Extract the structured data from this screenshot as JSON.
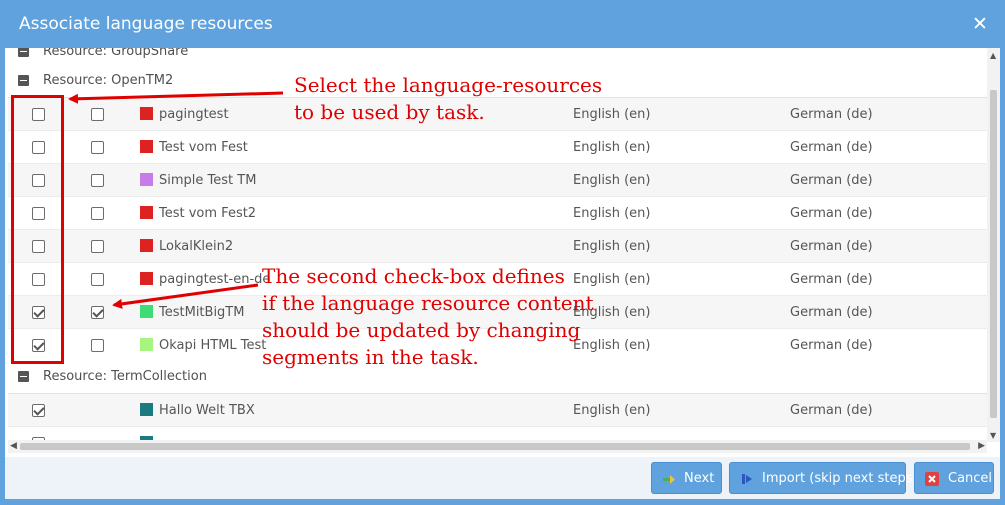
{
  "dialog": {
    "title": "Associate language resources",
    "close_icon": "close-icon"
  },
  "groups": {
    "groupshare": "Resource: GroupShare",
    "opentm2": "Resource: OpenTM2",
    "termcollection": "Resource: TermCollection"
  },
  "rows": [
    {
      "name": "pagingtest",
      "source": "English (en)",
      "target": "German (de)",
      "color": "#dd2222",
      "use": false,
      "update": false
    },
    {
      "name": "Test vom Fest",
      "source": "English (en)",
      "target": "German (de)",
      "color": "#dd2222",
      "use": false,
      "update": false
    },
    {
      "name": "Simple Test TM",
      "source": "English (en)",
      "target": "German (de)",
      "color": "#c67de8",
      "use": false,
      "update": false
    },
    {
      "name": "Test vom Fest2",
      "source": "English (en)",
      "target": "German (de)",
      "color": "#dd2222",
      "use": false,
      "update": false
    },
    {
      "name": "LokalKlein2",
      "source": "English (en)",
      "target": "German (de)",
      "color": "#dd2222",
      "use": false,
      "update": false
    },
    {
      "name": "pagingtest-en-de",
      "source": "English (en)",
      "target": "German (de)",
      "color": "#dd2222",
      "use": false,
      "update": false
    },
    {
      "name": "TestMitBigTM",
      "source": "English (en)",
      "target": "German (de)",
      "color": "#3ddc74",
      "use": true,
      "update": true
    },
    {
      "name": "Okapi HTML Test",
      "source": "English (en)",
      "target": "German (de)",
      "color": "#a6f57f",
      "use": true,
      "update": false
    }
  ],
  "term_rows": [
    {
      "name": "Hallo Welt TBX",
      "source": "English (en)",
      "target": "German (de)",
      "color": "#1b7a80",
      "use": true
    }
  ],
  "annotations": {
    "select_line1": "Select the language-resources",
    "select_line2": "to be used by task.",
    "second_line1": "The second check-box defines",
    "second_line2": "if the language resource content",
    "second_line3": "should be updated by changing",
    "second_line4": "segments in the task."
  },
  "buttons": {
    "next": "Next",
    "import": "Import (skip next steps)",
    "cancel": "Cancel"
  },
  "colors": {
    "header": "#5fa2dd",
    "annotation": "#e00000"
  }
}
